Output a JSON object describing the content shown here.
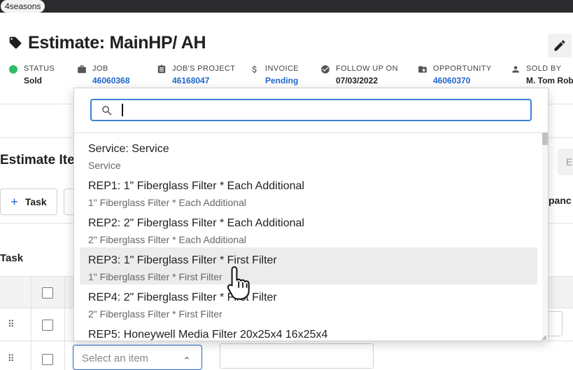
{
  "window": {
    "chip_label": "4seasons"
  },
  "header": {
    "title": "Estimate: MainHP/ AH"
  },
  "meta": [
    {
      "label": "STATUS",
      "value": "Sold",
      "icon": "green-dot-icon",
      "link": false
    },
    {
      "label": "JOB",
      "value": "46060368",
      "icon": "briefcase-icon",
      "link": true
    },
    {
      "label": "JOB'S PROJECT",
      "value": "46168047",
      "icon": "clipboard-icon",
      "link": true
    },
    {
      "label": "INVOICE",
      "value": "Pending",
      "icon": "dollar-icon",
      "link": true
    },
    {
      "label": "FOLLOW UP ON",
      "value": "07/03/2022",
      "icon": "check-circle-icon",
      "link": false
    },
    {
      "label": "OPPORTUNITY",
      "value": "46060370",
      "icon": "folder-star-icon",
      "link": true
    },
    {
      "label": "SOLD BY",
      "value": "M. Tom Rob",
      "icon": "person-icon",
      "link": false
    }
  ],
  "colors": {
    "link": "#1f66c9",
    "status_green": "#2dbd68",
    "focus": "#3b82d6"
  },
  "section": {
    "title": "Estimate Ite",
    "task_button": "Task",
    "expand_text": "panc",
    "right_button": "E"
  },
  "table": {
    "task_header": "Task"
  },
  "item_select": {
    "placeholder": "Select an item"
  },
  "dropdown": {
    "search_value": "",
    "highlighted_index": 3,
    "options": [
      {
        "title": "Service: Service",
        "subtitle": "Service"
      },
      {
        "title": "REP1: 1\" Fiberglass Filter * Each Additional",
        "subtitle": "1\" Fiberglass Filter * Each Additional"
      },
      {
        "title": "REP2: 2\" Fiberglass Filter * Each Additional",
        "subtitle": "2\" Fiberglass Filter * Each Additional"
      },
      {
        "title": "REP3: 1\" Fiberglass Filter * First Filter",
        "subtitle": "1\" Fiberglass Filter * First Filter"
      },
      {
        "title": "REP4: 2\" Fiberglass Filter * First Filter",
        "subtitle": "2\" Fiberglass Filter * First Filter"
      },
      {
        "title": "REP5: Honeywell Media Filter 20x25x4 16x25x4",
        "subtitle": ""
      }
    ]
  }
}
